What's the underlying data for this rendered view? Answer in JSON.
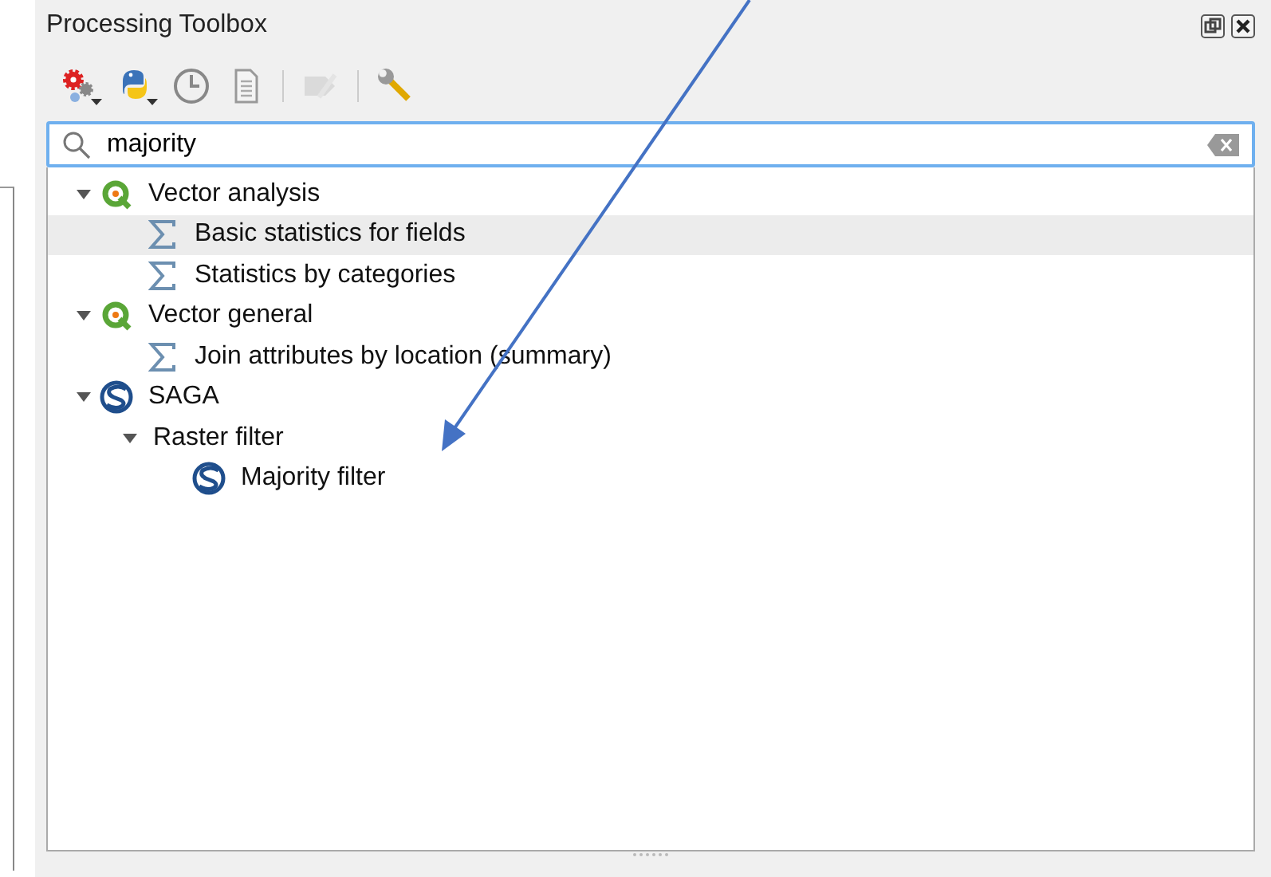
{
  "panel": {
    "title": "Processing Toolbox"
  },
  "toolbar": [
    {
      "kind": "gears",
      "dropdown": true,
      "disabled": false
    },
    {
      "kind": "python",
      "dropdown": true,
      "disabled": false
    },
    {
      "kind": "clock",
      "dropdown": false,
      "disabled": false
    },
    {
      "kind": "document",
      "dropdown": false,
      "disabled": false
    },
    {
      "kind": "separator"
    },
    {
      "kind": "edit",
      "dropdown": false,
      "disabled": true
    },
    {
      "kind": "separator"
    },
    {
      "kind": "wrench",
      "dropdown": false,
      "disabled": false
    }
  ],
  "search": {
    "value": "majority"
  },
  "tree": [
    {
      "label": "Vector analysis",
      "kind": "qgis",
      "expanded": true,
      "selected": false,
      "children": [
        {
          "label": "Basic statistics for fields",
          "kind": "sigma",
          "selected": true
        },
        {
          "label": "Statistics by categories",
          "kind": "sigma",
          "selected": false
        }
      ]
    },
    {
      "label": "Vector general",
      "kind": "qgis",
      "expanded": true,
      "selected": false,
      "children": [
        {
          "label": "Join attributes by location (summary)",
          "kind": "sigma",
          "selected": false
        }
      ]
    },
    {
      "label": "SAGA",
      "kind": "saga",
      "expanded": true,
      "selected": false,
      "children": [
        {
          "label": "Raster filter",
          "kind": "folder",
          "expanded": true,
          "selected": false,
          "children": [
            {
              "label": "Majority filter",
              "kind": "saga",
              "selected": false
            }
          ]
        }
      ]
    }
  ]
}
